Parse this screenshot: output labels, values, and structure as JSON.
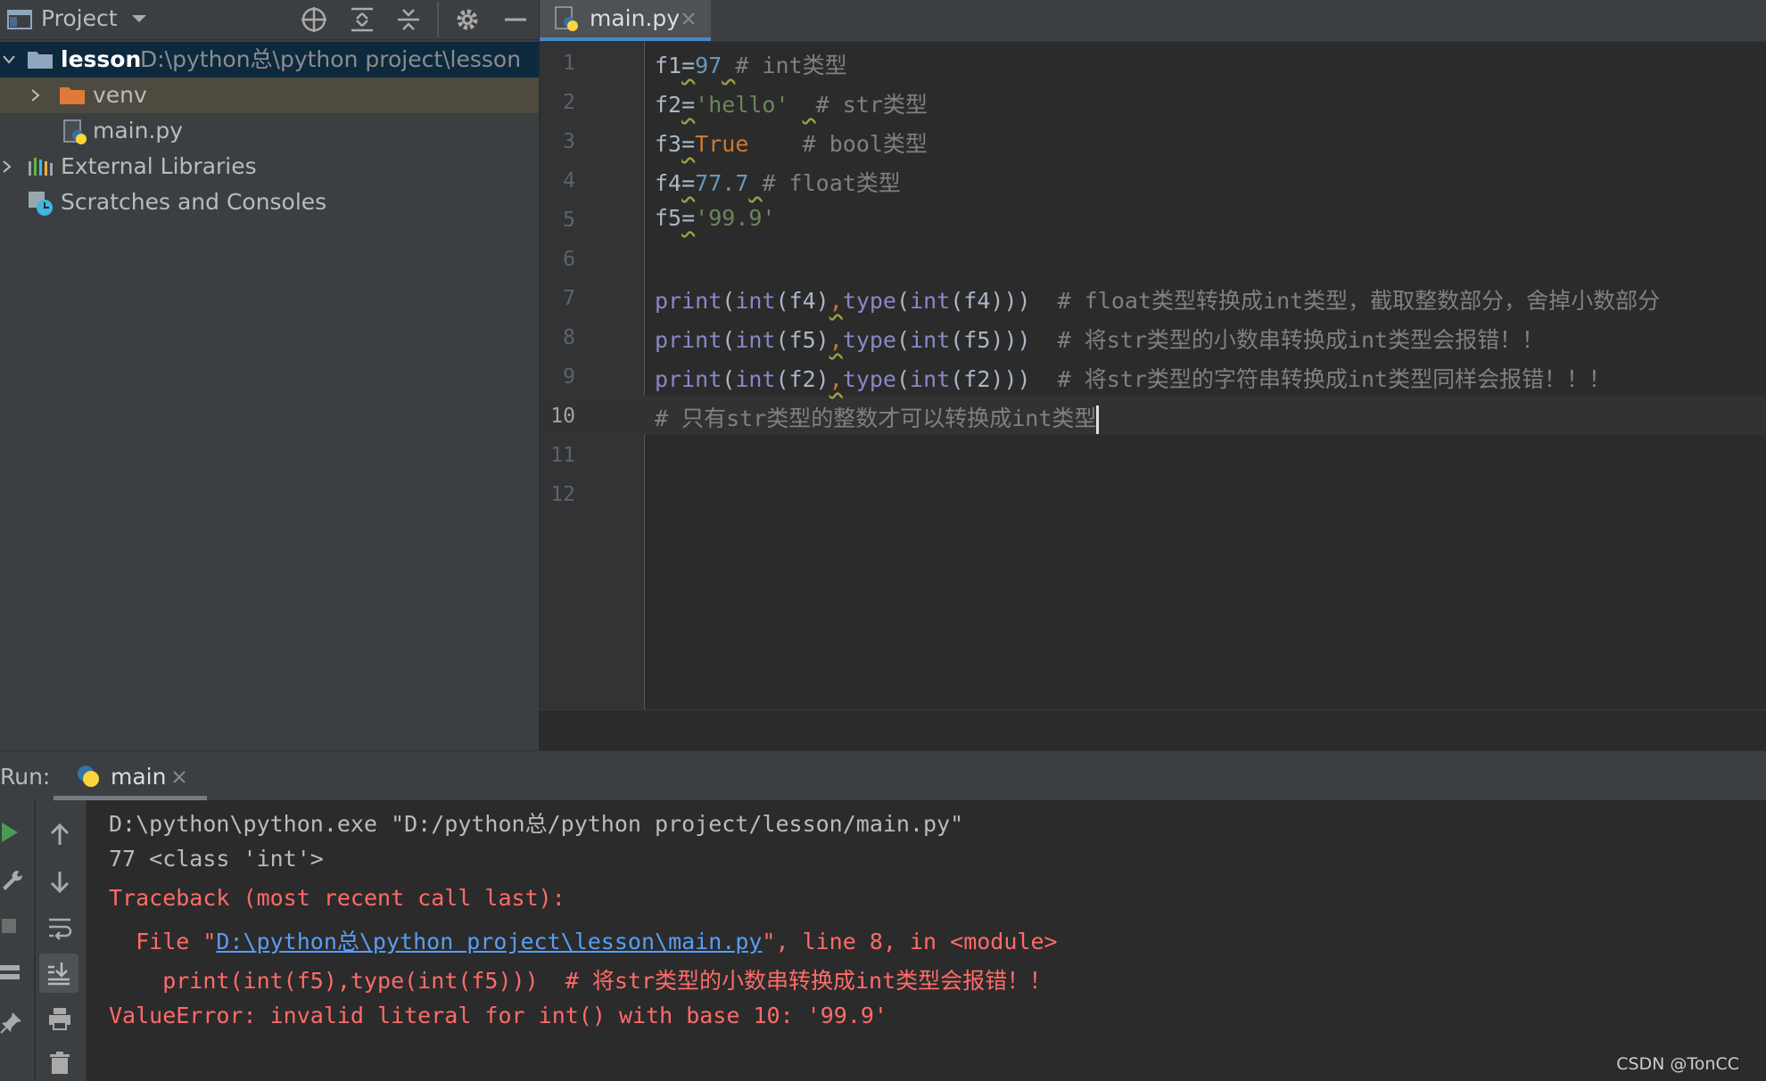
{
  "project_panel": {
    "title": "Project",
    "tree": [
      {
        "label": "lesson",
        "path": "D:\\python总\\python project\\lesson"
      },
      {
        "label": "venv"
      },
      {
        "label": "main.py"
      },
      {
        "label": "External Libraries"
      },
      {
        "label": "Scratches and Consoles"
      }
    ]
  },
  "editor": {
    "tab_label": "main.py",
    "line_numbers": [
      "1",
      "2",
      "3",
      "4",
      "5",
      "6",
      "7",
      "8",
      "9",
      "10",
      "11",
      "12"
    ],
    "current_line": "10",
    "lines": {
      "l1": {
        "var": "f1",
        "eq": "=",
        "val": "97",
        "comment": "# int类型"
      },
      "l2": {
        "var": "f2",
        "eq": "=",
        "val": "'hello'",
        "comment": "# str类型"
      },
      "l3": {
        "var": "f3",
        "eq": "=",
        "val": "True",
        "comment": "# bool类型"
      },
      "l4": {
        "var": "f4",
        "eq": "=",
        "val": "77.7",
        "comment": "# float类型"
      },
      "l5": {
        "var": "f5",
        "eq": "=",
        "val": "'99.9'"
      },
      "l7": {
        "print": "print",
        "int": "int",
        "arg": "f4",
        "type": "type",
        "comment": "# float类型转换成int类型，截取整数部分，舍掉小数部分"
      },
      "l8": {
        "print": "print",
        "int": "int",
        "arg": "f5",
        "type": "type",
        "comment": "# 将str类型的小数串转换成int类型会报错！！"
      },
      "l9": {
        "print": "print",
        "int": "int",
        "arg": "f2",
        "type": "type",
        "comment": "# 将str类型的字符串转换成int类型同样会报错！！！"
      },
      "l10": {
        "comment": "# 只有str类型的整数才可以转换成int类型"
      }
    }
  },
  "run_panel": {
    "label": "Run:",
    "tab_label": "main",
    "output": {
      "cmd": "D:\\python\\python.exe \"D:/python总/python project/lesson/main.py\"",
      "result": "77 <class 'int'>",
      "traceback": "Traceback (most recent call last):",
      "file_prefix": "  File \"",
      "file_link": "D:\\python总\\python project\\lesson\\main.py",
      "file_suffix": "\", line 8, in <module>",
      "code_line": "    print(int(f5),type(int(f5)))  # 将str类型的小数串转换成int类型会报错！！",
      "error": "ValueError: invalid literal for int() with base 10: '99.9'"
    }
  },
  "watermark": "CSDN @TonCC",
  "colors": {
    "panel_bg": "#3c3f41",
    "editor_bg": "#2b2b2b",
    "accent": "#4a88c7",
    "error": "#ff6b68",
    "link": "#589df6"
  }
}
